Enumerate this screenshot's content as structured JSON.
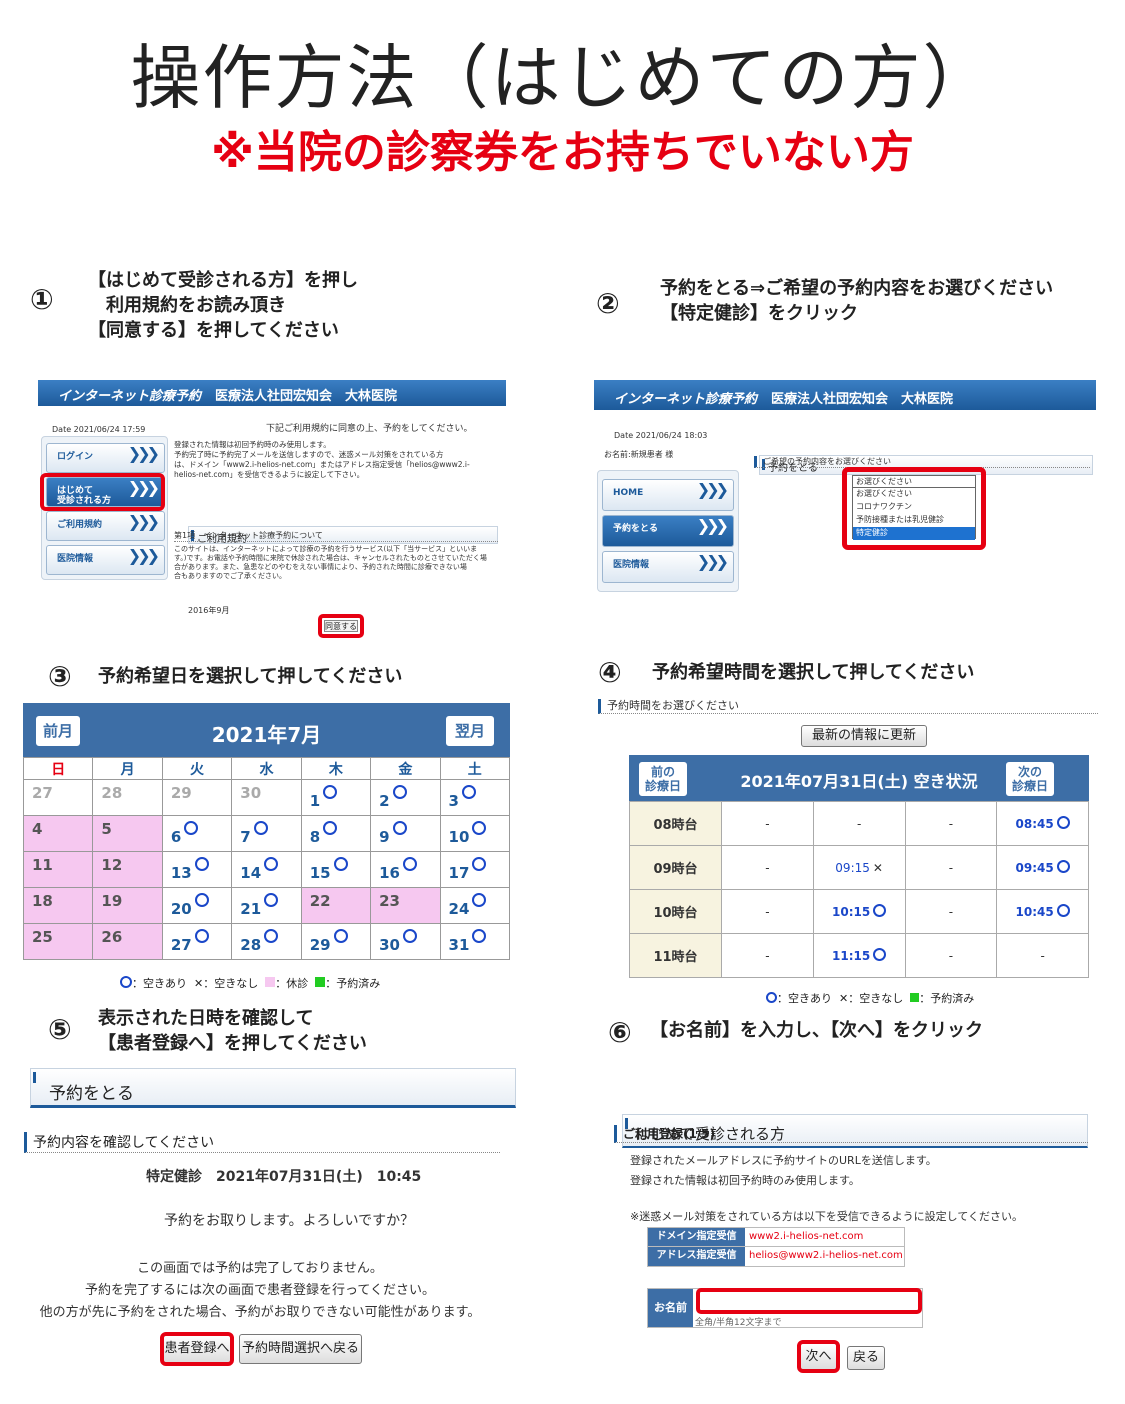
{
  "title": "操作方法（はじめての方）",
  "subtitle": "※当院の診察券をお持ちでいない方",
  "steps": [
    {
      "num": "①",
      "text": "【はじめて受診される方】を押し\n　利用規約をお読み頂き\n【同意する】を押してください"
    },
    {
      "num": "②",
      "text": "予約をとる⇒ご希望の予約内容をお選びください\n【特定健診】をクリック"
    },
    {
      "num": "③",
      "text": "予約希望日を選択して押してください"
    },
    {
      "num": "④",
      "text": "予約希望時間を選択して押してください"
    },
    {
      "num": "⑤",
      "text": "表示された日時を確認して\n【患者登録へ】を押してください"
    },
    {
      "num": "⑥",
      "text": "【お名前】を入力し、【次へ】をクリック"
    }
  ],
  "site": {
    "logo": "インターネット診療予約",
    "name": "医療法人社団宏知会　大林医院"
  },
  "s1": {
    "date": "Date 2021/06/24 17:59",
    "nav": [
      "ログイン",
      "はじめて\n受診される方",
      "ご利用規約",
      "医院情報"
    ],
    "intro": "下記ご利用規約に同意の上、予約をしてください。",
    "body": "登録された情報は初回予約時のみ使用します。\n予約完了時に予約完了メールを送信しますので、迷惑メール対策をされている方\nは、ドメイン「www2.i-helios-net.com」またはアドレス指定受信「helios@www2.i-\nhelios-net.com」を受信できるように設定して下さい。",
    "terms_heading": "ご利用規約",
    "article": "第1項　インターネット診療予約について",
    "article_body": "このサイトは、インターネットによって診療の予約を行うサービス(以下「当サービス」といいま\nす。)です。お電話や予約時間に来院で休診された場合は、キャンセルされたものとさせていただく場\n合があります。また、急患などのやむをえない事情により、予約された時間に診療できない場\n合もありますのでご了承ください。",
    "revised": "2016年9月",
    "agree_button": "同意する"
  },
  "s2": {
    "date": "Date 2021/06/24 18:03",
    "patient": "お名前:新規患者 様",
    "nav": [
      "HOME",
      "予約をとる",
      "医院情報"
    ],
    "section": "予約をとる",
    "prompt": "ご希望の予約内容をお選びください",
    "select_value": "お選びください",
    "options": [
      "お選びください",
      "コロナワクチン",
      "予防接種または乳児健診",
      "特定健診"
    ]
  },
  "cal": {
    "prev": "前月",
    "next": "翌月",
    "month": "2021年7月",
    "weekdays": [
      "日",
      "月",
      "火",
      "水",
      "木",
      "金",
      "土"
    ],
    "rows": [
      [
        {
          "d": "27",
          "s": "gray"
        },
        {
          "d": "28",
          "s": "gray"
        },
        {
          "d": "29",
          "s": "gray"
        },
        {
          "d": "30",
          "s": "gray"
        },
        {
          "d": "1",
          "s": "open"
        },
        {
          "d": "2",
          "s": "open"
        },
        {
          "d": "3",
          "s": "open"
        }
      ],
      [
        {
          "d": "4",
          "s": "closed"
        },
        {
          "d": "5",
          "s": "closed"
        },
        {
          "d": "6",
          "s": "open"
        },
        {
          "d": "7",
          "s": "open"
        },
        {
          "d": "8",
          "s": "open"
        },
        {
          "d": "9",
          "s": "open"
        },
        {
          "d": "10",
          "s": "open"
        }
      ],
      [
        {
          "d": "11",
          "s": "closed"
        },
        {
          "d": "12",
          "s": "closed"
        },
        {
          "d": "13",
          "s": "open"
        },
        {
          "d": "14",
          "s": "open"
        },
        {
          "d": "15",
          "s": "open"
        },
        {
          "d": "16",
          "s": "open"
        },
        {
          "d": "17",
          "s": "open"
        }
      ],
      [
        {
          "d": "18",
          "s": "closed"
        },
        {
          "d": "19",
          "s": "closed"
        },
        {
          "d": "20",
          "s": "open"
        },
        {
          "d": "21",
          "s": "open"
        },
        {
          "d": "22",
          "s": "closed"
        },
        {
          "d": "23",
          "s": "closed"
        },
        {
          "d": "24",
          "s": "open"
        }
      ],
      [
        {
          "d": "25",
          "s": "closed"
        },
        {
          "d": "26",
          "s": "closed"
        },
        {
          "d": "27",
          "s": "open"
        },
        {
          "d": "28",
          "s": "open"
        },
        {
          "d": "29",
          "s": "open"
        },
        {
          "d": "30",
          "s": "open"
        },
        {
          "d": "31",
          "s": "open"
        }
      ]
    ],
    "legend": {
      "open": "：空きあり",
      "full": "：空きなし",
      "closed": "：休診",
      "booked": "：予約済み"
    }
  },
  "times": {
    "section": "予約時間をお選びください",
    "refresh": "最新の情報に更新",
    "prev": "前の\n診療日",
    "next": "次の\n診療日",
    "heading": "2021年07月31日(土) 空き状況",
    "rows": [
      {
        "h": "08時台",
        "c": [
          "-",
          "-",
          "-",
          "08:45"
        ]
      },
      {
        "h": "09時台",
        "c": [
          "-",
          "09:15",
          "-",
          "09:45"
        ]
      },
      {
        "h": "10時台",
        "c": [
          "-",
          "10:15",
          "-",
          "10:45"
        ]
      },
      {
        "h": "11時台",
        "c": [
          "-",
          "11:15",
          "-",
          "-"
        ]
      }
    ],
    "status": [
      [
        "",
        "",
        "",
        "open"
      ],
      [
        "",
        "full",
        "",
        "open"
      ],
      [
        "",
        "open",
        "",
        "open"
      ],
      [
        "",
        "open",
        "",
        ""
      ]
    ]
  },
  "s5": {
    "section": "予約をとる",
    "confirm_heading": "予約内容を確認してください",
    "details": "特定健診　2021年07月31日(土)　10:45",
    "question": "予約をお取りします。よろしいですか？",
    "notice": "この画面では予約は完了しておりません。\n予約を完了するには次の画面で患者登録を行ってください。\n他の方が先に予約をされた場合、予約がお取りできない可能性があります。",
    "register_button": "患者登録へ",
    "back_button": "予約時間選択へ戻る"
  },
  "s6": {
    "section": "はじめて受診される方",
    "reg_heading": "ご利用登録(1/5)",
    "body": "登録されたメールアドレスに予約サイトのURLを送信します。\n登録された情報は初回予約時のみ使用します。",
    "note": "※迷惑メール対策をされている方は以下を受信できるように設定してください。",
    "domain_label": "ドメイン指定受信",
    "domain_value": "www2.i-helios-net.com",
    "address_label": "アドレス指定受信",
    "address_value": "helios@www2.i-helios-net.com",
    "name_label": "お名前",
    "name_value": "",
    "name_hint": "全角/半角12文字まで",
    "next_button": "次へ",
    "back_button": "戻る"
  },
  "colors": {
    "accent_red": "#e60012",
    "brand_blue": "#1d5a9a",
    "available_blue": "#1a47c9",
    "closed_pink": "#f6c8f0",
    "booked_green": "#22cc22"
  }
}
